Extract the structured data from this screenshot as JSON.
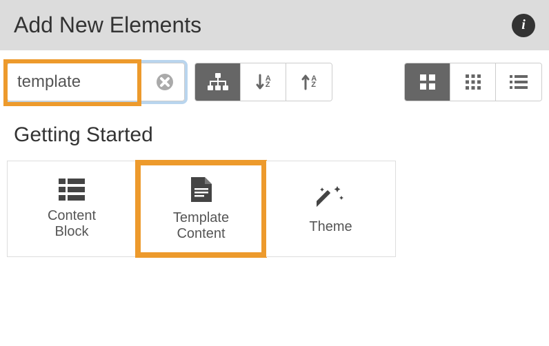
{
  "header": {
    "title": "Add New Elements",
    "info_icon": "i"
  },
  "toolbar": {
    "search_value": "template",
    "clear_icon": "clear",
    "sort_asc_label": "A\nZ",
    "sort_desc_label": "A\nZ"
  },
  "section": {
    "title": "Getting Started",
    "cards": [
      {
        "label": "Content\nBlock"
      },
      {
        "label": "Template\nContent"
      },
      {
        "label": "Theme"
      }
    ]
  }
}
